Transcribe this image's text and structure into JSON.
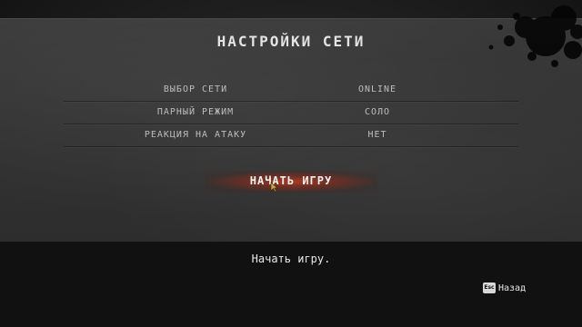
{
  "menu": {
    "title": "НАСТРОЙКИ СЕТИ",
    "options": [
      {
        "label": "ВЫБОР СЕТИ",
        "value": "ONLINE"
      },
      {
        "label": "ПАРНЫЙ РЕЖИМ",
        "value": "СОЛО"
      },
      {
        "label": "РЕАКЦИЯ НА АТАКУ",
        "value": "НЕТ"
      }
    ],
    "start_label": "НАЧАТЬ ИГРУ"
  },
  "footer": {
    "hint": "Начать игру.",
    "back_key": "Esc",
    "back_label": "Назад"
  },
  "colors": {
    "accent": "#b83a1e",
    "text": "#e4e4e4"
  }
}
